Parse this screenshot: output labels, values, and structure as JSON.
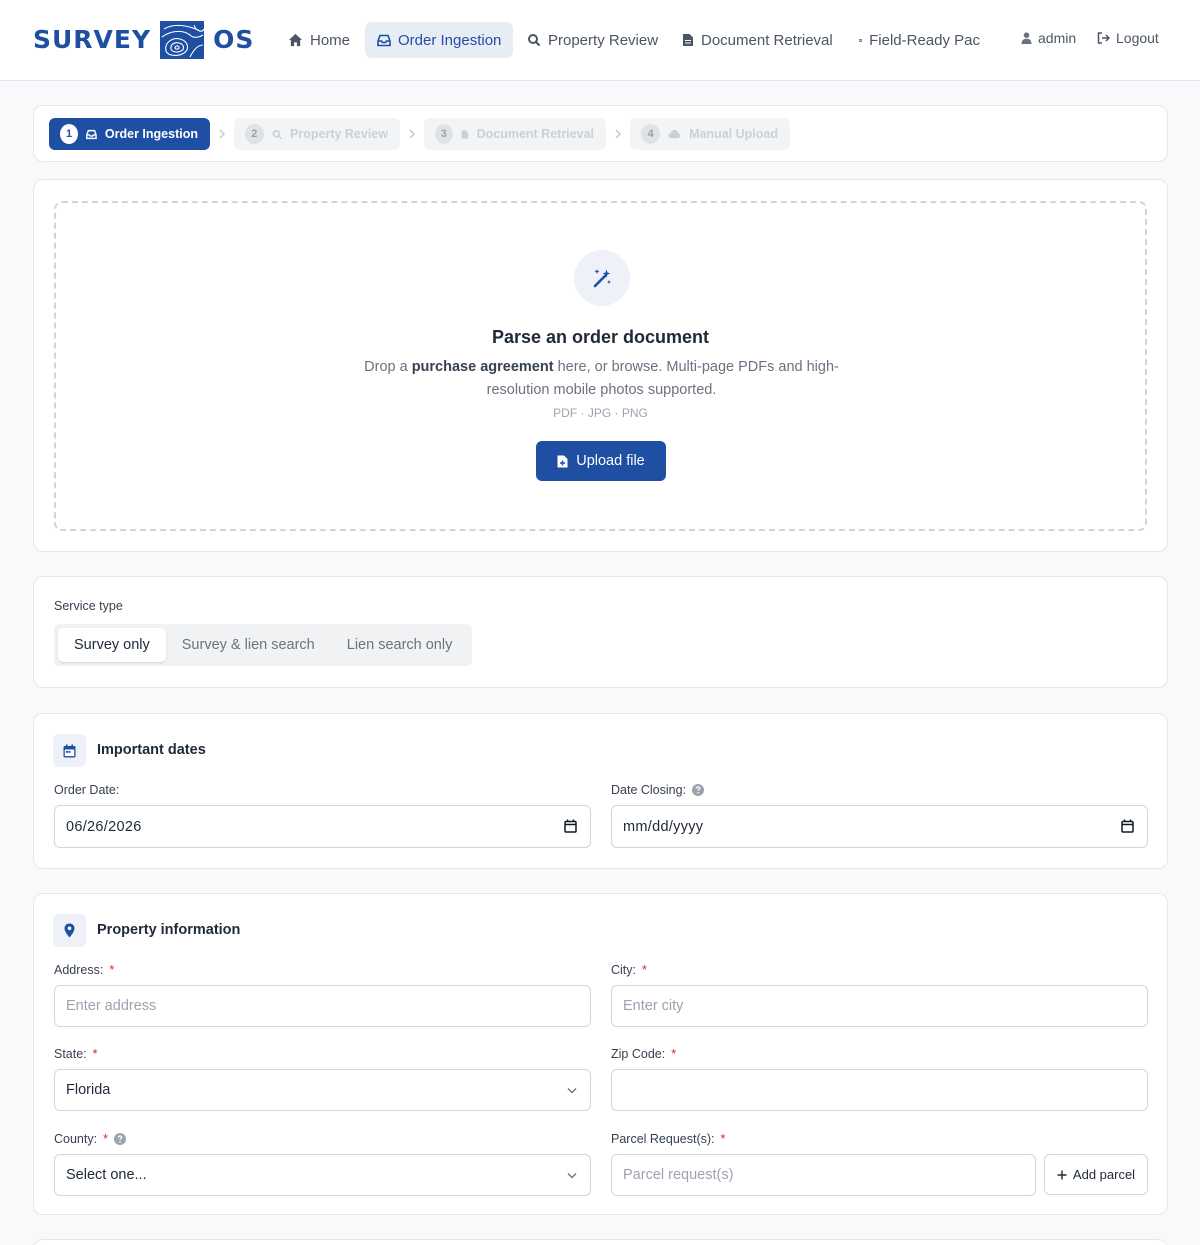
{
  "brand": {
    "left": "SURVEY",
    "right": "OS"
  },
  "nav": {
    "items": [
      {
        "label": "Home",
        "icon": "home-icon"
      },
      {
        "label": "Order Ingestion",
        "icon": "inbox-icon",
        "active": true
      },
      {
        "label": "Property Review",
        "icon": "search-icon"
      },
      {
        "label": "Document Retrieval",
        "icon": "document-icon"
      },
      {
        "label": "Field-Ready Pac",
        "icon": "archive-icon"
      }
    ],
    "user": "admin",
    "logout": "Logout"
  },
  "steps": [
    {
      "num": "1",
      "label": "Order Ingestion",
      "icon": "inbox-icon",
      "active": true
    },
    {
      "num": "2",
      "label": "Property Review",
      "icon": "search-icon",
      "active": false
    },
    {
      "num": "3",
      "label": "Document Retrieval",
      "icon": "document-icon",
      "active": false
    },
    {
      "num": "4",
      "label": "Manual Upload",
      "icon": "cloud-upload-icon",
      "active": false
    }
  ],
  "upload": {
    "title": "Parse an order document",
    "desc_prefix": "Drop a",
    "desc_bold": "purchase agreement",
    "desc_suffix": "here, or browse. Multi-page PDFs and high-resolution mobile photos supported.",
    "types": "PDF · JPG · PNG",
    "button": "Upload file"
  },
  "service": {
    "label": "Service type",
    "options": [
      "Survey only",
      "Survey & lien search",
      "Lien search only"
    ],
    "selected": "Survey only"
  },
  "dates": {
    "title": "Important dates",
    "order_label": "Order Date:",
    "order_value": "06/26/2026",
    "closing_label": "Date Closing:",
    "closing_value": "mm/dd/yyyy"
  },
  "property": {
    "title": "Property information",
    "required_mark": "*",
    "address_label": "Address:",
    "address_placeholder": "Enter address",
    "city_label": "City:",
    "city_placeholder": "Enter city",
    "state_label": "State:",
    "state_value": "Florida",
    "zip_label": "Zip Code:",
    "zip_value": "",
    "county_label": "County:",
    "county_value": "Select one...",
    "parcel_label": "Parcel Request(s):",
    "parcel_placeholder": "Parcel request(s)",
    "add_parcel": "Add parcel"
  },
  "colors": {
    "primary": "#1e4fa3",
    "required": "#dc2626",
    "background": "#f8f9fb"
  }
}
